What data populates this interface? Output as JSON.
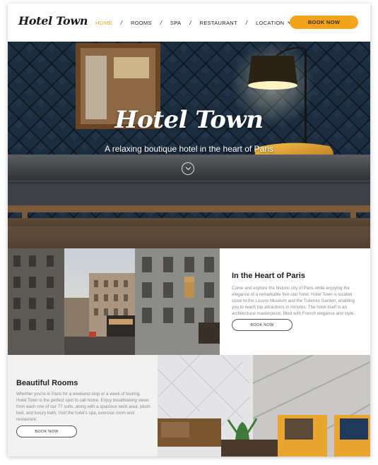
{
  "nav": {
    "logo": "Hotel Town",
    "items": [
      {
        "label": "HOME",
        "active": true
      },
      {
        "label": "ROOMS"
      },
      {
        "label": "SPA"
      },
      {
        "label": "RESTAURANT"
      },
      {
        "label": "LOCATION"
      }
    ],
    "separator": "/",
    "book_label": "BOOK NOW"
  },
  "hero": {
    "title": "Hotel Town",
    "subtitle": "A relaxing boutique hotel in the heart of Paris"
  },
  "section_paris": {
    "heading": "In the Heart of Paris",
    "body": "Come and explore the historic city of Paris while enjoying the elegance of a remarkable five-star hotel. Hotel Town is located close to the Louvre Museum and the Tuileries Garden, enabling you to reach top attractions in minutes. The hotel itself is an architectural masterpiece, filled with French elegance and style.",
    "button": "BOOK NOW"
  },
  "section_rooms": {
    "heading": "Beautiful Rooms",
    "body": "Whether you're in Paris for a weekend stop or a week of touring, Hotel Town is the perfect spot to call home. Enjoy breathtaking views from each one of our 77 suits, along with a spacious work area, plush bed, and luxury bath. Visit the hotel's spa, exercise room and restaurant.",
    "button": "BOOK NOW"
  },
  "colors": {
    "accent": "#f2a41c",
    "text_dark": "#1f1f1f",
    "text_muted": "#8a8a8a"
  }
}
